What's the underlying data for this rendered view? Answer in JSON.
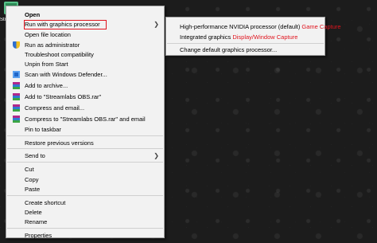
{
  "desktop": {
    "icon_label": "Str"
  },
  "context_menu": {
    "open": "Open",
    "run_gpu": "Run with graphics processor",
    "open_file_location": "Open file location",
    "run_as_admin": "Run as administrator",
    "troubleshoot": "Troubleshoot compatibility",
    "unpin_start": "Unpin from Start",
    "scan_defender": "Scan with Windows Defender...",
    "add_archive": "Add to archive...",
    "add_rar": "Add to \"Streamlabs OBS.rar\"",
    "compress_email": "Compress and email...",
    "compress_rar_email": "Compress to \"Streamlabs OBS.rar\" and email",
    "pin_taskbar": "Pin to taskbar",
    "restore_versions": "Restore previous versions",
    "send_to": "Send to",
    "cut": "Cut",
    "copy": "Copy",
    "paste": "Paste",
    "create_shortcut": "Create shortcut",
    "delete": "Delete",
    "rename": "Rename",
    "properties": "Properties"
  },
  "submenu": {
    "high_performance": "High-performance NVIDIA processor (default)",
    "high_performance_note": "Game Capture",
    "integrated": "Integrated graphics",
    "integrated_note": "Display/Window Capture",
    "change_default": "Change default graphics processor..."
  },
  "colors": {
    "annotation": "#e0141e",
    "menu_bg": "#f2f2f2"
  }
}
